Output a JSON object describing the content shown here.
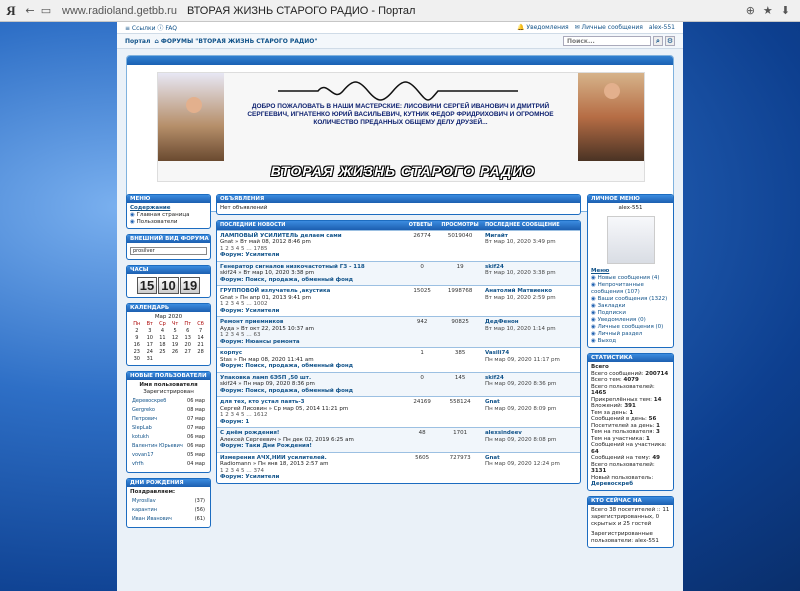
{
  "browser": {
    "logo": "Я",
    "url": "www.radioland.getbb.ru",
    "title": "ВТОРАЯ ЖИЗНЬ СТАРОГО РАДИО - Портал"
  },
  "topbar": {
    "left": "≡ Ссылки  ⓘ FAQ",
    "notifications": "🔔 Уведомления",
    "messages": "✉ Личные сообщения",
    "user": "alex-551"
  },
  "crumbs": {
    "portal": "Портал",
    "forums": "⌂ ФОРУМЫ \"ВТОРАЯ ЖИЗНЬ СТАРОГО РАДИО\"",
    "search_placeholder": "Поиск..."
  },
  "banner": {
    "text": "ДОБРО ПОЖАЛОВАТЬ В НАШИ МАСТЕРСКИЕ: ЛИСОВИНИ СЕРГЕЙ ИВАНОВИЧ И ДМИТРИЙ СЕРГЕЕВИЧ, ИГНАТЕНКО ЮРИЙ ВАСИЛЬЕВИЧ, КУТНИК ФЕДОР ФРИДРИХОВИЧ И ОГРОМНОЕ КОЛИЧЕСТВО ПРЕДАННЫХ ОБЩЕМУ ДЕЛУ ДРУЗЕЙ...",
    "logo": "ВТОРАЯ ЖИЗНЬ СТАРОГО РАДИО"
  },
  "menu": {
    "title": "МЕНЮ",
    "head": "Содержание",
    "items": [
      "Главная страница",
      "Пользователи"
    ]
  },
  "style": {
    "title": "ВНЕШНИЙ ВИД ФОРУМА",
    "value": "prosilver"
  },
  "clock": {
    "title": "ЧАСЫ",
    "h": "15",
    "m": "10",
    "s": "19"
  },
  "calendar": {
    "title": "КАЛЕНДАРЬ",
    "month": "Мар 2020",
    "days": [
      "Пн",
      "Вт",
      "Ср",
      "Чт",
      "Пт",
      "Сб"
    ],
    "rows": [
      [
        "2",
        "3",
        "4",
        "5",
        "6",
        "7"
      ],
      [
        "9",
        "10",
        "11",
        "12",
        "13",
        "14"
      ],
      [
        "16",
        "17",
        "18",
        "19",
        "20",
        "21"
      ],
      [
        "23",
        "24",
        "25",
        "26",
        "27",
        "28"
      ],
      [
        "30",
        "31",
        "",
        "",
        "",
        "",
        ""
      ]
    ]
  },
  "newusers": {
    "title": "НОВЫЕ ПОЛЬЗОВАТЕЛИ",
    "head": "Имя пользователя",
    "sub": "Зарегистрирован",
    "rows": [
      [
        "Деревоскреб",
        "06 мар"
      ],
      [
        "Gergreko",
        "08 мар"
      ],
      [
        "Петрович",
        "07 мар"
      ],
      [
        "SlepLab",
        "07 мар"
      ],
      [
        "kotukh",
        "06 мар"
      ],
      [
        "Валентин Юрьевич",
        "06 мар"
      ],
      [
        "vovan17",
        "05 мар"
      ],
      [
        "vfrfh",
        "04 мар"
      ]
    ]
  },
  "birthdays": {
    "title": "ДНИ РОЖДЕНИЯ",
    "head": "Поздравляем:",
    "rows": [
      [
        "Myrosllav",
        "(37)"
      ],
      [
        "карантин",
        "(56)"
      ],
      [
        "Иван Иванович",
        "(61)"
      ]
    ]
  },
  "announce": {
    "title": "ОБЪЯВЛЕНИЯ",
    "text": "Нет объявлений"
  },
  "topics": {
    "headers": [
      "ПОСЛЕДНИЕ НОВОСТИ",
      "ОТВЕТЫ",
      "ПРОСМОТРЫ",
      "ПОСЛЕДНЕЕ СООБЩЕНИЕ"
    ],
    "rows": [
      {
        "t": "ЛАМПОВЫЙ УСИЛИТЕЛЬ делаем сами",
        "meta": "Gnat » Вт май 08, 2012 8:46 pm",
        "pages": "1 2 3 4 5 … 1785",
        "forum": "Форум: Усилители",
        "r": "26774",
        "v": "5019040",
        "lu": "Мигайт",
        "ld": "Вт мар 10, 2020 3:49 pm"
      },
      {
        "t": "Генератор сигналов низкочастотный ГЗ - 118",
        "meta": "skif24 » Вт мар 10, 2020 3:38 pm",
        "pages": "",
        "forum": "Форум: Поиск, продажа, обменный фонд",
        "r": "0",
        "v": "19",
        "lu": "skif24",
        "ld": "Вт мар 10, 2020 3:38 pm"
      },
      {
        "t": "ГРУППОВОЙ излучатель ,акустика",
        "meta": "Gnat » Пн апр 01, 2013 9:41 pm",
        "pages": "1 2 3 4 5 … 1002",
        "forum": "Форум: Усилители",
        "r": "15025",
        "v": "1998768",
        "lu": "Анатолий Матвиенко",
        "ld": "Вт мар 10, 2020 2:59 pm"
      },
      {
        "t": "Ремонт приемников",
        "meta": "Ауда » Вт окт 22, 2015 10:37 am",
        "pages": "1 2 3 4 5 … 63",
        "forum": "Форум: Нюансы ремонта",
        "r": "942",
        "v": "90825",
        "lu": "ДедФенон",
        "ld": "Вт мар 10, 2020 1:14 pm"
      },
      {
        "t": "корпус",
        "meta": "Stas » Пн мар 08, 2020 11:41 am",
        "pages": "",
        "forum": "Форум: Поиск, продажа, обменный фонд",
        "r": "1",
        "v": "385",
        "lu": "Vasili74",
        "ld": "Пн мар 09, 2020 11:17 pm"
      },
      {
        "t": "Упаковка ламп 6Э5П ,50 шт.",
        "meta": "skif24 » Пн мар 09, 2020 8:36 pm",
        "pages": "",
        "forum": "Форум: Поиск, продажа, обменный фонд",
        "r": "0",
        "v": "145",
        "lu": "skif24",
        "ld": "Пн мар 09, 2020 8:36 pm"
      },
      {
        "t": "для тех, кто устал паять-3",
        "meta": "Сергей Лисовин » Ср мар 05, 2014 11:21 pm",
        "pages": "1 2 3 4 5 … 1612",
        "forum": "Форум: 1",
        "r": "24169",
        "v": "558124",
        "lu": "Gnat",
        "ld": "Пн мар 09, 2020 8:09 pm"
      },
      {
        "t": "С днём рождения!",
        "meta": "Алексей Сергеевич » Пн дек 02, 2019 6:25 am",
        "pages": "",
        "forum": "Форум: Таки Дни Рождения!",
        "r": "48",
        "v": "1701",
        "lu": "alexsindeev",
        "ld": "Пн мар 09, 2020 8:08 pm"
      },
      {
        "t": "Измерения АЧХ,НИИ усилителей.",
        "meta": "Radiomann » Пн янв 18, 2013 2:57 am",
        "pages": "1 2 3 4 5 … 374",
        "forum": "Форум: Усилители",
        "r": "5605",
        "v": "727973",
        "lu": "Gnat",
        "ld": "Пн мар 09, 2020 12:24 pm"
      }
    ]
  },
  "personal": {
    "title": "ЛИЧНОЕ МЕНЮ",
    "user": "alex-551",
    "head": "Меню",
    "items": [
      "Новые сообщения (4)",
      "Непрочитанные сообщения (107)",
      "Ваши сообщения (1322)",
      "Закладки",
      "Подписки",
      "Уведомления (0)",
      "Личные сообщения (0)",
      "Личный раздел",
      "Выход"
    ]
  },
  "stats": {
    "title": "СТАТИСТИКА",
    "head": "Всего",
    "lines": [
      [
        "Всего сообщений:",
        "200714"
      ],
      [
        "Всего тем:",
        "4079"
      ],
      [
        "Всего пользователей:",
        "1465"
      ],
      [
        "Прикреплённых тем:",
        "14"
      ],
      [
        "Вложений:",
        "391"
      ],
      [
        "Тем за день:",
        "1"
      ],
      [
        "Сообщений в день:",
        "56"
      ],
      [
        "Посетителей за день:",
        "1"
      ],
      [
        "Тем на пользователя:",
        "3"
      ],
      [
        "Тем на участника:",
        "1"
      ],
      [
        "Сообщений на участника:",
        "64"
      ],
      [
        "Сообщений на тему:",
        "49"
      ],
      [
        "Всего пользователей:",
        "3131"
      ]
    ],
    "newest_label": "Новый пользователь:",
    "newest": "Деревоскреб"
  },
  "whosonline": {
    "title": "КТО СЕЙЧАС НА ФОРУМЕ?",
    "text": "Всего 38 посетителей :: 11 зарегистрированных, 0 скрытых и 25 гостей",
    "text2": "Зарегистрированные пользователи: alex-551"
  }
}
